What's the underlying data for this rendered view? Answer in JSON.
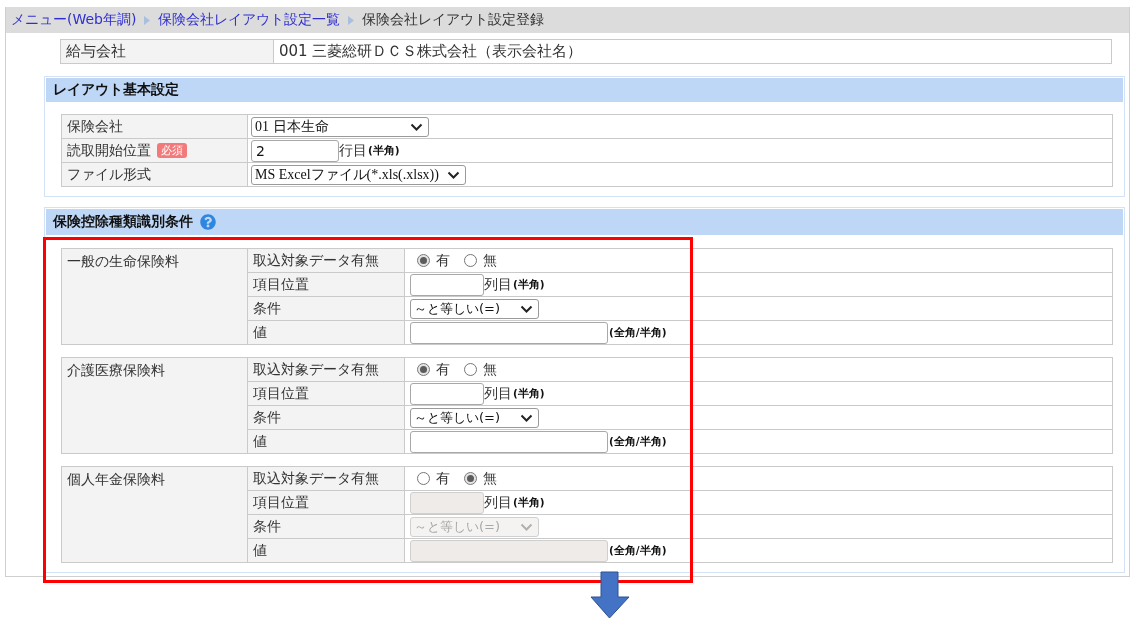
{
  "breadcrumb": [
    {
      "label": "メニュー(Web年調)",
      "kind": "link"
    },
    {
      "label": "保険会社レイアウト設定一覧",
      "kind": "link"
    },
    {
      "label": "保険会社レイアウト設定登録",
      "kind": "current"
    }
  ],
  "payroll_company": {
    "label": "給与会社",
    "value": "001 三菱総研ＤＣＳ株式会社（表示会社名）"
  },
  "layout_settings": {
    "title": "レイアウト基本設定",
    "rows": [
      {
        "label": "保険会社",
        "kind": "select",
        "value": "01 日本生命"
      },
      {
        "label": "読取開始位置",
        "badge": "必須",
        "kind": "short_input",
        "value": "2",
        "unit": "行目",
        "note": "(半角)"
      },
      {
        "label": "ファイル形式",
        "kind": "select",
        "value": "MS Excelファイル(*.xls(.xlsx))"
      }
    ]
  },
  "identification_conditions": {
    "title": "保険控除種類識別条件",
    "groups": [
      {
        "name": "一般の生命保険料",
        "rows": [
          {
            "label": "取込対象データ有無",
            "kind": "radio",
            "options": [
              {
                "label": "有",
                "selected": true
              },
              {
                "label": "無",
                "selected": false
              }
            ]
          },
          {
            "label": "項目位置",
            "kind": "short_input",
            "unit": "列目",
            "note": "(半角)",
            "disabled": false
          },
          {
            "label": "条件",
            "kind": "select",
            "value": "～と等しい(=)",
            "disabled": false
          },
          {
            "label": "値",
            "kind": "long_input",
            "note": "(全角/半角)",
            "disabled": false
          }
        ]
      },
      {
        "name": "介護医療保険料",
        "rows": [
          {
            "label": "取込対象データ有無",
            "kind": "radio",
            "options": [
              {
                "label": "有",
                "selected": true
              },
              {
                "label": "無",
                "selected": false
              }
            ]
          },
          {
            "label": "項目位置",
            "kind": "short_input",
            "unit": "列目",
            "note": "(半角)",
            "disabled": false
          },
          {
            "label": "条件",
            "kind": "select",
            "value": "～と等しい(=)",
            "disabled": false
          },
          {
            "label": "値",
            "kind": "long_input",
            "note": "(全角/半角)",
            "disabled": false
          }
        ]
      },
      {
        "name": "個人年金保険料",
        "rows": [
          {
            "label": "取込対象データ有無",
            "kind": "radio",
            "options": [
              {
                "label": "有",
                "selected": false
              },
              {
                "label": "無",
                "selected": true
              }
            ]
          },
          {
            "label": "項目位置",
            "kind": "short_input",
            "unit": "列目",
            "note": "(半角)",
            "disabled": true
          },
          {
            "label": "条件",
            "kind": "select",
            "value": "～と等しい(=)",
            "disabled": true
          },
          {
            "label": "値",
            "kind": "long_input",
            "note": "(全角/半角)",
            "disabled": true
          }
        ]
      }
    ]
  }
}
